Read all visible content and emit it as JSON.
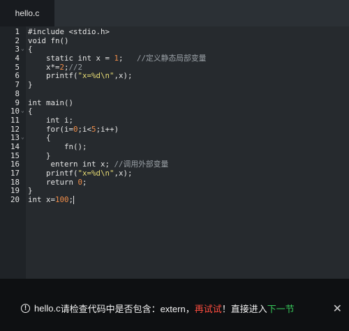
{
  "tab": {
    "title": "hello.c"
  },
  "editor": {
    "lines": [
      {
        "n": "1",
        "parts": [
          {
            "t": "#include <stdio.h>",
            "c": ""
          }
        ]
      },
      {
        "n": "2",
        "parts": [
          {
            "t": "void fn()",
            "c": ""
          }
        ]
      },
      {
        "n": "3",
        "fold": true,
        "parts": [
          {
            "t": "{",
            "c": ""
          }
        ]
      },
      {
        "n": "4",
        "parts": [
          {
            "t": "    static int x = ",
            "c": ""
          },
          {
            "t": "1",
            "c": "num"
          },
          {
            "t": ";   ",
            "c": ""
          },
          {
            "t": "//定义静态局部变量",
            "c": "cmt"
          }
        ]
      },
      {
        "n": "5",
        "parts": [
          {
            "t": "    x*=",
            "c": ""
          },
          {
            "t": "2",
            "c": "num"
          },
          {
            "t": ";",
            "c": ""
          },
          {
            "t": "//2",
            "c": "cmt"
          }
        ]
      },
      {
        "n": "6",
        "parts": [
          {
            "t": "    printf(",
            "c": ""
          },
          {
            "t": "\"x=%d\\n\"",
            "c": "str"
          },
          {
            "t": ",x);",
            "c": ""
          }
        ]
      },
      {
        "n": "7",
        "parts": [
          {
            "t": "}",
            "c": ""
          }
        ]
      },
      {
        "n": "8",
        "parts": [
          {
            "t": "",
            "c": ""
          }
        ]
      },
      {
        "n": "9",
        "parts": [
          {
            "t": "int main()",
            "c": ""
          }
        ]
      },
      {
        "n": "10",
        "fold": true,
        "parts": [
          {
            "t": "{",
            "c": ""
          }
        ]
      },
      {
        "n": "11",
        "parts": [
          {
            "t": "    int i;",
            "c": ""
          }
        ]
      },
      {
        "n": "12",
        "parts": [
          {
            "t": "    for(i=",
            "c": ""
          },
          {
            "t": "0",
            "c": "num"
          },
          {
            "t": ";i<",
            "c": ""
          },
          {
            "t": "5",
            "c": "num"
          },
          {
            "t": ";i++)",
            "c": ""
          }
        ]
      },
      {
        "n": "13",
        "fold": true,
        "parts": [
          {
            "t": "    {",
            "c": ""
          }
        ]
      },
      {
        "n": "14",
        "parts": [
          {
            "t": "        fn();",
            "c": ""
          }
        ]
      },
      {
        "n": "15",
        "parts": [
          {
            "t": "    }",
            "c": ""
          }
        ]
      },
      {
        "n": "16",
        "parts": [
          {
            "t": "     entern int x; ",
            "c": ""
          },
          {
            "t": "//调用外部变量",
            "c": "cmt"
          }
        ]
      },
      {
        "n": "17",
        "parts": [
          {
            "t": "    printf(",
            "c": ""
          },
          {
            "t": "\"x=%d\\n\"",
            "c": "str"
          },
          {
            "t": ",x);",
            "c": ""
          }
        ]
      },
      {
        "n": "18",
        "parts": [
          {
            "t": "    return ",
            "c": ""
          },
          {
            "t": "0",
            "c": "num"
          },
          {
            "t": ";",
            "c": ""
          }
        ]
      },
      {
        "n": "19",
        "parts": [
          {
            "t": "}",
            "c": ""
          }
        ]
      },
      {
        "n": "20",
        "cursor": true,
        "parts": [
          {
            "t": "int x=",
            "c": ""
          },
          {
            "t": "100",
            "c": "num"
          },
          {
            "t": ";",
            "c": ""
          }
        ]
      }
    ]
  },
  "toast": {
    "file": "hello.c",
    "message": " 请检查代码中是否包含：extern，",
    "retry": "再试试",
    "middle": "！直接进入",
    "next": "下一节"
  },
  "icons": {
    "fold": "chevron-down-icon",
    "info": "info-circle-icon",
    "close": "close-icon"
  }
}
